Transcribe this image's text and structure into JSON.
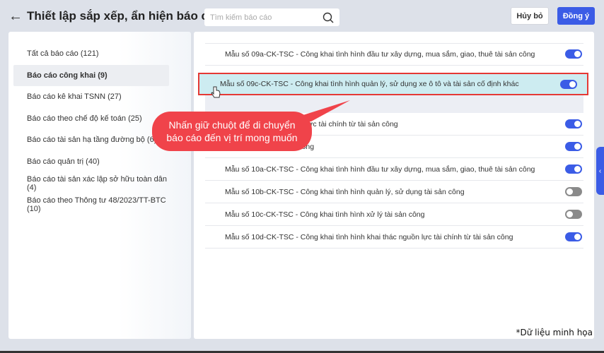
{
  "header": {
    "title": "Thiết lập sắp xếp, ẩn hiện báo cáo",
    "search_placeholder": "Tìm kiếm báo cáo",
    "cancel_label": "Hủy bỏ",
    "ok_label": "Đồng ý"
  },
  "sidebar": {
    "items": [
      {
        "label": "Tất cả báo cáo (121)",
        "active": false
      },
      {
        "label": "Báo cáo công khai (9)",
        "active": true
      },
      {
        "label": "Báo cáo kê khai TSNN (27)",
        "active": false
      },
      {
        "label": "Báo cáo theo chế độ kế toán (25)",
        "active": false
      },
      {
        "label": "Báo cáo tài sản hạ tầng đường bộ (6)",
        "active": false
      },
      {
        "label": "Báo cáo quản trị (40)",
        "active": false
      },
      {
        "label": "Báo cáo tài sản xác lập sở hữu toàn dân (4)",
        "active": false
      },
      {
        "label": "Báo cáo theo Thông tư 48/2023/TT-BTC (10)",
        "active": false
      }
    ]
  },
  "reports": [
    {
      "label": "Mẫu số 09a-CK-TSC - Công khai tình hình đầu tư xây dựng, mua sắm, giao, thuê tài sản công",
      "enabled": true
    },
    {
      "label": "nh hình khai thác nguồn lực tài chính từ tài sản công",
      "enabled": true
    },
    {
      "label": "tình hình xử lý tài sản công",
      "enabled": true
    },
    {
      "label": "Mẫu số 10a-CK-TSC - Công khai tình hình đầu tư xây dựng, mua sắm, giao, thuê tài sản công",
      "enabled": true
    },
    {
      "label": "Mẫu số 10b-CK-TSC - Công khai tình hình quản lý, sử dụng tài sản công",
      "enabled": false
    },
    {
      "label": "Mẫu số 10c-CK-TSC - Công khai tình hình xử lý tài sản công",
      "enabled": false
    },
    {
      "label": "Mẫu số 10d-CK-TSC - Công khai tình hình khai thác nguồn lực tài chính từ tài sản công",
      "enabled": true
    }
  ],
  "dragging": {
    "label": "Mẫu số 09c-CK-TSC - Công khai tình hình quản lý, sử dụng xe ô tô và tài sản cố định khác",
    "enabled": true
  },
  "tooltip": {
    "line1": "Nhấn giữ chuột để di chuyển",
    "line2": "báo cáo đến vị trí mong muốn"
  },
  "note": "*Dữ liệu minh họa",
  "colors": {
    "accent": "#3b5ce6",
    "highlight_border": "#e53935",
    "tooltip": "#f0434a",
    "drag_bg": "#cdecf1"
  }
}
